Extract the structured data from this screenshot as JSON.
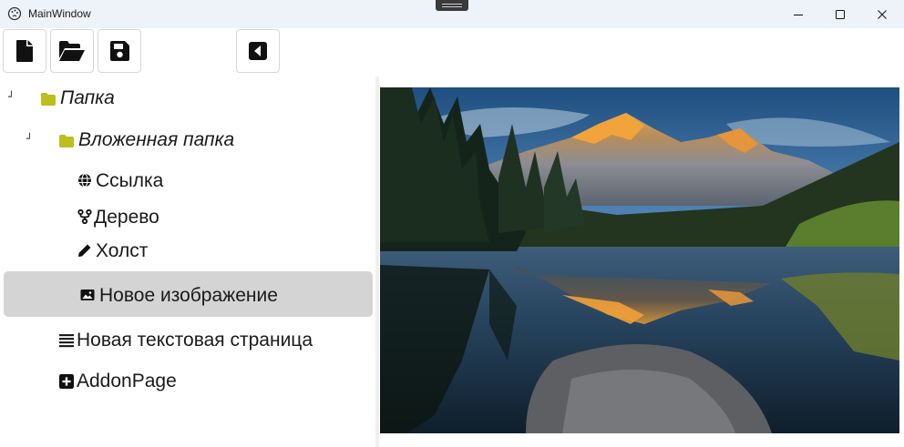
{
  "window": {
    "title": "MainWindow"
  },
  "toolbar": {
    "buttons": [
      {
        "id": "new",
        "icon": "new-file-icon"
      },
      {
        "id": "open",
        "icon": "folder-open-icon"
      },
      {
        "id": "save",
        "icon": "save-icon"
      },
      {
        "id": "back",
        "icon": "caret-left-icon"
      }
    ]
  },
  "tree": {
    "items": [
      {
        "label": "Папка",
        "icon": "folder-icon",
        "expanded": true
      },
      {
        "label": "Вложенная папка",
        "icon": "folder-icon",
        "expanded": true
      },
      {
        "label": "Ссылка",
        "icon": "globe-icon"
      },
      {
        "label": "Дерево",
        "icon": "branch-icon"
      },
      {
        "label": "Холст",
        "icon": "pencil-icon"
      },
      {
        "label": "Новое изображение",
        "icon": "image-icon",
        "selected": true
      },
      {
        "label": "Новая текстовая страница",
        "icon": "list-icon"
      },
      {
        "label": "AddonPage",
        "icon": "plus-square-icon"
      }
    ]
  },
  "colors": {
    "folder": "#bcbf1c",
    "selection": "#d4d4d4",
    "titlebar": "#eef2f9"
  }
}
